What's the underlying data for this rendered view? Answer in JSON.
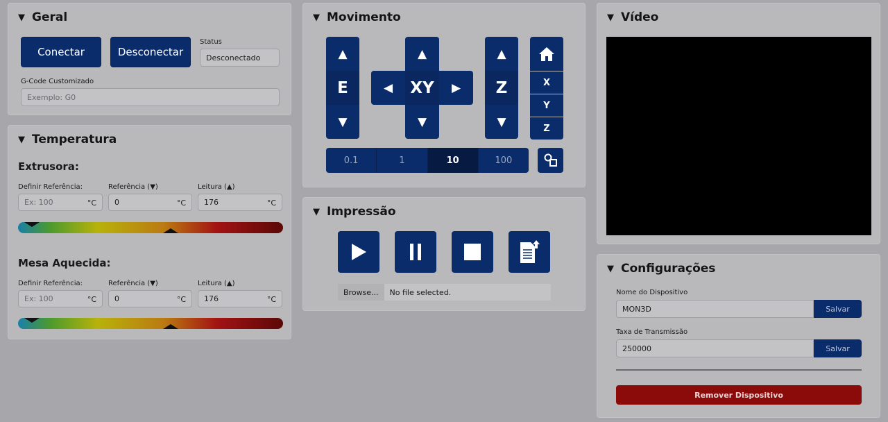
{
  "geral": {
    "title": "Geral",
    "connect_label": "Conectar",
    "disconnect_label": "Desconectar",
    "status_label": "Status",
    "status_value": "Desconectado",
    "gcode_label": "G-Code Customizado",
    "gcode_placeholder": "Exemplo: G0"
  },
  "temperatura": {
    "title": "Temperatura",
    "extrusora": {
      "label": "Extrusora:",
      "def_ref_label": "Definir Referência:",
      "def_ref_placeholder": "Ex: 100",
      "ref_label": "Referência (▼)",
      "ref_value": "0",
      "leitura_label": "Leitura (▲)",
      "leitura_value": "176",
      "unit": "°C"
    },
    "mesa": {
      "label": "Mesa Aquecida:",
      "def_ref_label": "Definir Referência:",
      "def_ref_placeholder": "Ex: 100",
      "ref_label": "Referência (▼)",
      "ref_value": "0",
      "leitura_label": "Leitura (▲)",
      "leitura_value": "176",
      "unit": "°C"
    }
  },
  "movimento": {
    "title": "Movimento",
    "e_label": "E",
    "xy_label": "XY",
    "z_label": "Z",
    "home_x": "X",
    "home_y": "Y",
    "home_z": "Z",
    "steps": [
      "0.1",
      "1",
      "10",
      "100"
    ],
    "active_step": "10",
    "arrow_up": "▲",
    "arrow_down": "▼",
    "arrow_left": "◀",
    "arrow_right": "▶"
  },
  "impressao": {
    "title": "Impressão",
    "browse_label": "Browse...",
    "file_status": "No file selected."
  },
  "video": {
    "title": "Vídeo"
  },
  "config": {
    "title": "Configurações",
    "device_name_label": "Nome do Dispositivo",
    "device_name_value": "MON3D",
    "baud_label": "Taxa de Transmissão",
    "baud_value": "250000",
    "save_label": "Salvar",
    "remove_label": "Remover Dispositivo"
  },
  "colors": {
    "accent": "#0b2c6b",
    "danger": "#8b0a0a",
    "background": "#a7a7ab"
  }
}
